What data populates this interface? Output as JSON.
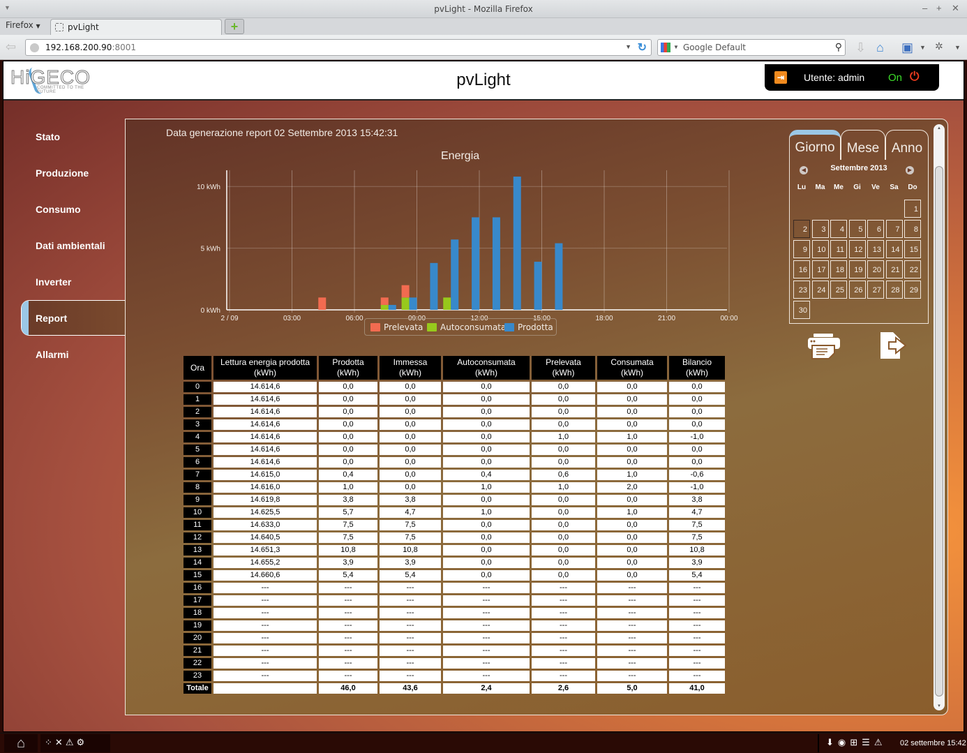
{
  "browser": {
    "window_title": "pvLight - Mozilla Firefox",
    "menu_button": "Firefox",
    "tab_title": "pvLight",
    "url_host": "192.168.200.90",
    "url_port": ":8001",
    "search_engine": "Google Default"
  },
  "header": {
    "logo_text": "HiGECO",
    "logo_tagline": "COMMITTED TO THE FUTURE",
    "app_title": "pvLight",
    "user_label": "Utente: admin",
    "status": "On"
  },
  "sidebar": {
    "items": [
      {
        "label": "Stato"
      },
      {
        "label": "Produzione"
      },
      {
        "label": "Consumo"
      },
      {
        "label": "Dati ambientali"
      },
      {
        "label": "Inverter"
      },
      {
        "label": "Report",
        "active": true
      },
      {
        "label": "Allarmi"
      }
    ]
  },
  "report": {
    "generated": "Data generazione report 02 Settembre 2013 15:42:31"
  },
  "chart_data": {
    "type": "bar",
    "title": "Energia",
    "xlabel": "",
    "ylabel": "",
    "x": [
      0,
      1,
      2,
      3,
      4,
      5,
      6,
      7,
      8,
      9,
      10,
      11,
      12,
      13,
      14,
      15,
      16,
      17,
      18,
      19,
      20,
      21,
      22,
      23
    ],
    "xtick_labels": [
      "2 / 09",
      "03:00",
      "06:00",
      "09:00",
      "12:00",
      "15:00",
      "18:00",
      "21:00",
      "00:00"
    ],
    "ytick_labels": [
      "0 kWh",
      "5 kWh",
      "10 kWh"
    ],
    "yticks": [
      0,
      5,
      10
    ],
    "ylim": [
      0,
      11.2
    ],
    "grid": true,
    "legend_position": "bottom",
    "series": [
      {
        "name": "Prelevata",
        "color": "#f26b50",
        "stack": "consumo",
        "values": [
          0,
          0,
          0,
          0,
          1.0,
          0,
          0,
          0.6,
          1.0,
          0,
          0,
          0,
          0,
          0,
          0,
          0,
          null,
          null,
          null,
          null,
          null,
          null,
          null,
          null
        ]
      },
      {
        "name": "Autoconsumata",
        "color": "#97c91c",
        "stack": "consumo",
        "values": [
          0,
          0,
          0,
          0,
          0,
          0,
          0,
          0.4,
          1.0,
          0,
          1.0,
          0,
          0,
          0,
          0,
          0,
          null,
          null,
          null,
          null,
          null,
          null,
          null,
          null
        ]
      },
      {
        "name": "Prodotta",
        "color": "#3889cb",
        "stack": "prod",
        "values": [
          0,
          0,
          0,
          0,
          0,
          0,
          0,
          0.4,
          1.0,
          3.8,
          5.7,
          7.5,
          7.5,
          10.8,
          3.9,
          5.4,
          null,
          null,
          null,
          null,
          null,
          null,
          null,
          null
        ]
      }
    ]
  },
  "table": {
    "headers": [
      {
        "l1": "Ora",
        "l2": ""
      },
      {
        "l1": "Lettura energia prodotta",
        "l2": "(kWh)"
      },
      {
        "l1": "Prodotta",
        "l2": "(kWh)"
      },
      {
        "l1": "Immessa",
        "l2": "(kWh)"
      },
      {
        "l1": "Autoconsumata",
        "l2": "(kWh)"
      },
      {
        "l1": "Prelevata",
        "l2": "(kWh)"
      },
      {
        "l1": "Consumata",
        "l2": "(kWh)"
      },
      {
        "l1": "Bilancio",
        "l2": "(kWh)"
      }
    ],
    "rows": [
      [
        "0",
        "14.614,6",
        "0,0",
        "0,0",
        "0,0",
        "0,0",
        "0,0",
        "0,0"
      ],
      [
        "1",
        "14.614,6",
        "0,0",
        "0,0",
        "0,0",
        "0,0",
        "0,0",
        "0,0"
      ],
      [
        "2",
        "14.614,6",
        "0,0",
        "0,0",
        "0,0",
        "0,0",
        "0,0",
        "0,0"
      ],
      [
        "3",
        "14.614,6",
        "0,0",
        "0,0",
        "0,0",
        "0,0",
        "0,0",
        "0,0"
      ],
      [
        "4",
        "14.614,6",
        "0,0",
        "0,0",
        "0,0",
        "1,0",
        "1,0",
        "-1,0"
      ],
      [
        "5",
        "14.614,6",
        "0,0",
        "0,0",
        "0,0",
        "0,0",
        "0,0",
        "0,0"
      ],
      [
        "6",
        "14.614,6",
        "0,0",
        "0,0",
        "0,0",
        "0,0",
        "0,0",
        "0,0"
      ],
      [
        "7",
        "14.615,0",
        "0,4",
        "0,0",
        "0,4",
        "0,6",
        "1,0",
        "-0,6"
      ],
      [
        "8",
        "14.616,0",
        "1,0",
        "0,0",
        "1,0",
        "1,0",
        "2,0",
        "-1,0"
      ],
      [
        "9",
        "14.619,8",
        "3,8",
        "3,8",
        "0,0",
        "0,0",
        "0,0",
        "3,8"
      ],
      [
        "10",
        "14.625,5",
        "5,7",
        "4,7",
        "1,0",
        "0,0",
        "1,0",
        "4,7"
      ],
      [
        "11",
        "14.633,0",
        "7,5",
        "7,5",
        "0,0",
        "0,0",
        "0,0",
        "7,5"
      ],
      [
        "12",
        "14.640,5",
        "7,5",
        "7,5",
        "0,0",
        "0,0",
        "0,0",
        "7,5"
      ],
      [
        "13",
        "14.651,3",
        "10,8",
        "10,8",
        "0,0",
        "0,0",
        "0,0",
        "10,8"
      ],
      [
        "14",
        "14.655,2",
        "3,9",
        "3,9",
        "0,0",
        "0,0",
        "0,0",
        "3,9"
      ],
      [
        "15",
        "14.660,6",
        "5,4",
        "5,4",
        "0,0",
        "0,0",
        "0,0",
        "5,4"
      ],
      [
        "16",
        "---",
        "---",
        "---",
        "---",
        "---",
        "---",
        "---"
      ],
      [
        "17",
        "---",
        "---",
        "---",
        "---",
        "---",
        "---",
        "---"
      ],
      [
        "18",
        "---",
        "---",
        "---",
        "---",
        "---",
        "---",
        "---"
      ],
      [
        "19",
        "---",
        "---",
        "---",
        "---",
        "---",
        "---",
        "---"
      ],
      [
        "20",
        "---",
        "---",
        "---",
        "---",
        "---",
        "---",
        "---"
      ],
      [
        "21",
        "---",
        "---",
        "---",
        "---",
        "---",
        "---",
        "---"
      ],
      [
        "22",
        "---",
        "---",
        "---",
        "---",
        "---",
        "---",
        "---"
      ],
      [
        "23",
        "---",
        "---",
        "---",
        "---",
        "---",
        "---",
        "---"
      ]
    ],
    "total": [
      "Totale",
      "",
      "46,0",
      "43,6",
      "2,4",
      "2,6",
      "5,0",
      "41,0"
    ]
  },
  "calendar": {
    "tabs": [
      "Giorno",
      "Mese",
      "Anno"
    ],
    "active_tab": "Giorno",
    "month_label": "Settembre 2013",
    "weekdays": [
      "Lu",
      "Ma",
      "Me",
      "Gi",
      "Ve",
      "Sa",
      "Do"
    ],
    "first_weekday_index": 6,
    "days_in_month": 30,
    "selected_day": 2
  },
  "actions": {
    "print_icon": "print-icon",
    "export_icon": "export-icon"
  },
  "taskbar": {
    "clock": "02 settembre 15:42"
  }
}
